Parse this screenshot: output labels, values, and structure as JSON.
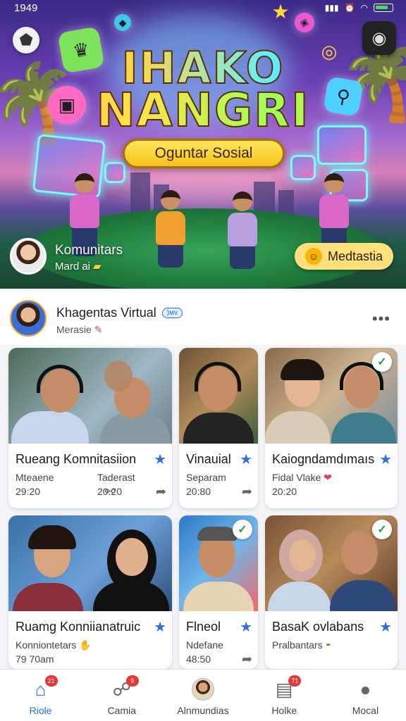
{
  "status_bar": {
    "time": "1949"
  },
  "hero": {
    "title_line1": "IHAKO",
    "title_line2": "NANGRI",
    "cta_label": "Oguntar Sosial",
    "host": {
      "name": "Komunitars",
      "subtitle": "Mard ai"
    },
    "meditate_button": "Medtastia"
  },
  "profile": {
    "name": "Khagentas Virtual",
    "badge": ")ᴍᴠ",
    "subtitle": "Merasie"
  },
  "cards": [
    {
      "title": "Rueang Komnitasiion",
      "line1": "Mteaene",
      "line2": "29:20",
      "right1": "Taderast",
      "right2": "20.20",
      "checked": false
    },
    {
      "title": "Vinauial",
      "line1": "Separam",
      "line2": "20:80",
      "right1": "",
      "right2": "",
      "checked": false
    },
    {
      "title": "Kaiogndamdımaıs",
      "line1": "Fidal Vlake",
      "line2": "20:20",
      "right1": "",
      "right2": "",
      "checked": true
    },
    {
      "title": "Ruamg Konniianatruic",
      "line1": "Konniontetars",
      "line2": "79 70am",
      "right1": "",
      "right2": "",
      "checked": false
    },
    {
      "title": "Flneol",
      "line1": "Ndefane",
      "line2": "48:50",
      "right1": "",
      "right2": "",
      "checked": true
    },
    {
      "title": "BasaK ovlabans",
      "line1": "Pralbantars",
      "line2": "",
      "right1": "",
      "right2": "",
      "checked": true
    }
  ],
  "nav": [
    {
      "label": "Riole",
      "badge": "21",
      "icon": "home-icon",
      "active": true
    },
    {
      "label": "Camia",
      "badge": "9",
      "icon": "chat-icon",
      "active": false
    },
    {
      "label": "Alnmundias",
      "badge": "",
      "icon": "avatar-icon",
      "active": false
    },
    {
      "label": "Holke",
      "badge": "71",
      "icon": "inbox-icon",
      "active": false
    },
    {
      "label": "Mocal",
      "badge": "",
      "icon": "profile-icon",
      "active": false
    }
  ],
  "colors": {
    "accent": "#1f6fe5",
    "cta": "#f5c21b",
    "badge": "#e53935",
    "check": "#1e9e4a"
  }
}
